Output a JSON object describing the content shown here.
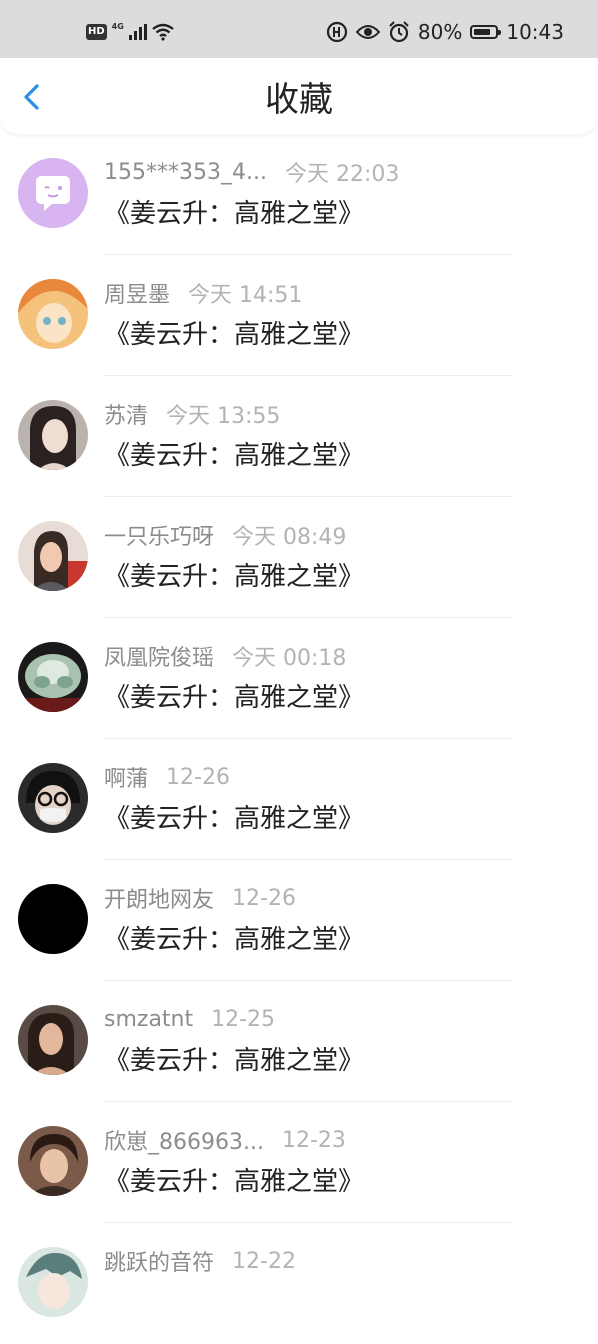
{
  "status_bar": {
    "hd": "HD",
    "network": "4G",
    "battery": "80%",
    "time": "10:43"
  },
  "header": {
    "title": "收藏"
  },
  "items": [
    {
      "name": "155***353_4...",
      "time": "今天 22:03",
      "title": "《姜云升：高雅之堂》",
      "avatar": "chat-bubble-avatar"
    },
    {
      "name": "周昱墨",
      "time": "今天 14:51",
      "title": "《姜云升：高雅之堂》",
      "avatar": "anime-girl-avatar"
    },
    {
      "name": "苏清",
      "time": "今天 13:55",
      "title": "《姜云升：高雅之堂》",
      "avatar": "woman-portrait-avatar"
    },
    {
      "name": "一只乐巧呀",
      "time": "今天 08:49",
      "title": "《姜云升：高雅之堂》",
      "avatar": "woman-selfie-avatar"
    },
    {
      "name": "凤凰院俊瑶",
      "time": "今天 00:18",
      "title": "《姜云升：高雅之堂》",
      "avatar": "jade-cabbage-avatar"
    },
    {
      "name": "啊蒲",
      "time": "12-26",
      "title": "《姜云升：高雅之堂》",
      "avatar": "glasses-mask-avatar"
    },
    {
      "name": "开朗地网友",
      "time": "12-26",
      "title": "《姜云升：高雅之堂》",
      "avatar": "black-avatar"
    },
    {
      "name": "smzatnt",
      "time": "12-25",
      "title": "《姜云升：高雅之堂》",
      "avatar": "woman-dark-avatar"
    },
    {
      "name": "欣崽_866963...",
      "time": "12-23",
      "title": "《姜云升：高雅之堂》",
      "avatar": "man-portrait-avatar"
    },
    {
      "name": "跳跃的音符",
      "time": "12-22",
      "title": "",
      "avatar": "anime-avatar"
    }
  ]
}
